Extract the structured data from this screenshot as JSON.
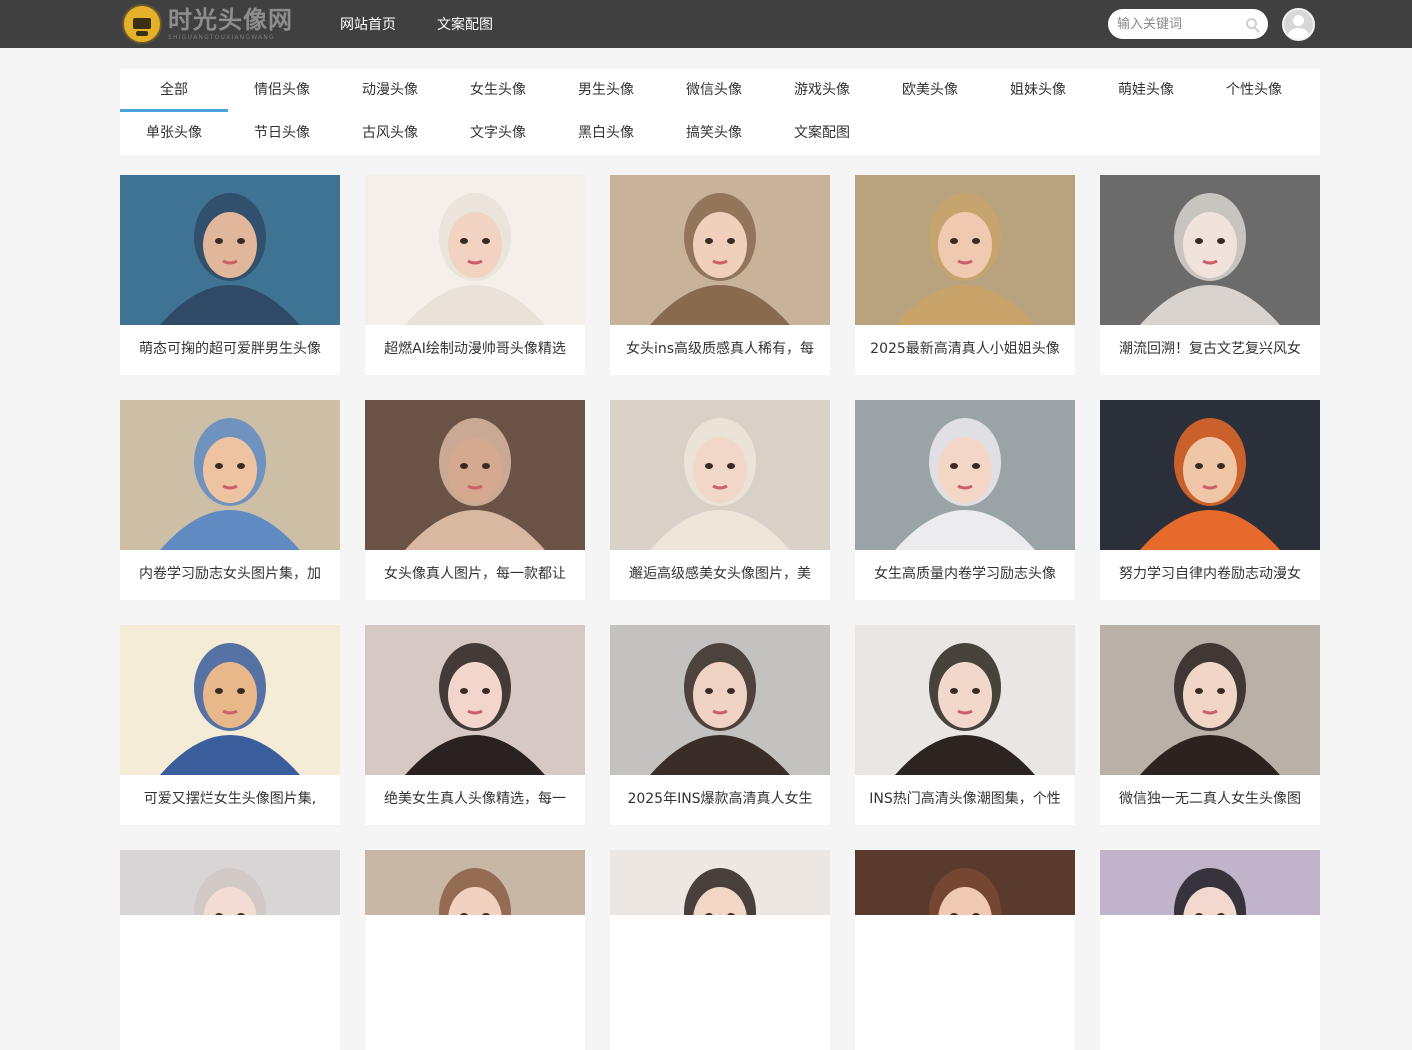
{
  "header": {
    "logo_text": "时光头像网",
    "logo_subtext": "SHIGUANGTOUXIANGWANG",
    "nav": [
      {
        "label": "网站首页"
      },
      {
        "label": "文案配图"
      }
    ],
    "search_placeholder": "输入关键词"
  },
  "categories": [
    {
      "label": "全部",
      "active": true
    },
    {
      "label": "情侣头像"
    },
    {
      "label": "动漫头像"
    },
    {
      "label": "女生头像"
    },
    {
      "label": "男生头像"
    },
    {
      "label": "微信头像"
    },
    {
      "label": "游戏头像"
    },
    {
      "label": "欧美头像"
    },
    {
      "label": "姐妹头像"
    },
    {
      "label": "萌娃头像"
    },
    {
      "label": "个性头像"
    },
    {
      "label": "单张头像"
    },
    {
      "label": "节日头像"
    },
    {
      "label": "古风头像"
    },
    {
      "label": "文字头像"
    },
    {
      "label": "黑白头像"
    },
    {
      "label": "搞笑头像"
    },
    {
      "label": "文案配图"
    }
  ],
  "cards": [
    {
      "title": "萌态可掬的超可爱胖男生头像",
      "bg": "#3f7393",
      "fg": "#2e4a66",
      "skin": "#e0b79a"
    },
    {
      "title": "超燃AI绘制动漫帅哥头像精选",
      "bg": "#f4efe9",
      "fg": "#e8e2d8",
      "skin": "#f2d2c0"
    },
    {
      "title": "女头ins高级质感真人稀有，每",
      "bg": "#c9b29a",
      "fg": "#8a6a4e",
      "skin": "#f0cfbb"
    },
    {
      "title": "2025最新高清真人小姐姐头像",
      "bg": "#b9a27e",
      "fg": "#c8a46a",
      "skin": "#efc9b0"
    },
    {
      "title": "潮流回溯！复古文艺复兴风女",
      "bg": "#6b6b6b",
      "fg": "#d8d3cf",
      "skin": "#f1e3dc"
    },
    {
      "title": "内卷学习励志女头图片集，加",
      "bg": "#cdbfa6",
      "fg": "#5f8ac2",
      "skin": "#eec3a2"
    },
    {
      "title": "女头像真人图片，每一款都让",
      "bg": "#6b5246",
      "fg": "#d9b8a2",
      "skin": "#d4a98f"
    },
    {
      "title": "邂逅高级感美女头像图片，美",
      "bg": "#d8d1c8",
      "fg": "#efe6da",
      "skin": "#f1d7c8"
    },
    {
      "title": "女生高质量内卷学习励志头像",
      "bg": "#9aa3a5",
      "fg": "#ecebee",
      "skin": "#f3d6c6"
    },
    {
      "title": "努力学习自律内卷励志动漫女",
      "bg": "#2b2f3a",
      "fg": "#e66a2c",
      "skin": "#f0c7a6"
    },
    {
      "title": "可爱又摆烂女生头像图片集,",
      "bg": "#f4ecd7",
      "fg": "#3a5d9c",
      "skin": "#e8b88a"
    },
    {
      "title": "绝美女生真人头像精选，每一",
      "bg": "#d8c8c4",
      "fg": "#2a2220",
      "skin": "#f3d6cb"
    },
    {
      "title": "2025年INS爆款高清真人女生",
      "bg": "#c4c2c0",
      "fg": "#3a2c26",
      "skin": "#f0d3c4"
    },
    {
      "title": "INS热门高清头像潮图集，个性",
      "bg": "#e9e6e3",
      "fg": "#2b2420",
      "skin": "#f2d8cb"
    },
    {
      "title": "微信独一无二真人女生头像图",
      "bg": "#b9b0a8",
      "fg": "#2a2320",
      "skin": "#f1d6c8"
    },
    {
      "title": "",
      "bg": "#d9d4d6",
      "fg": "#cfc7c3",
      "skin": "#f3dcd3"
    },
    {
      "title": "",
      "bg": "#c9b7a6",
      "fg": "#8a5f44",
      "skin": "#f1d1bf"
    },
    {
      "title": "",
      "bg": "#ece7e3",
      "fg": "#2b221e",
      "skin": "#f2d6c6"
    },
    {
      "title": "",
      "bg": "#5a3a2c",
      "fg": "#7a4a34",
      "skin": "#f0c9b3"
    },
    {
      "title": "",
      "bg": "#bfb4c9",
      "fg": "#1f1b22",
      "skin": "#f2d8cf"
    }
  ]
}
